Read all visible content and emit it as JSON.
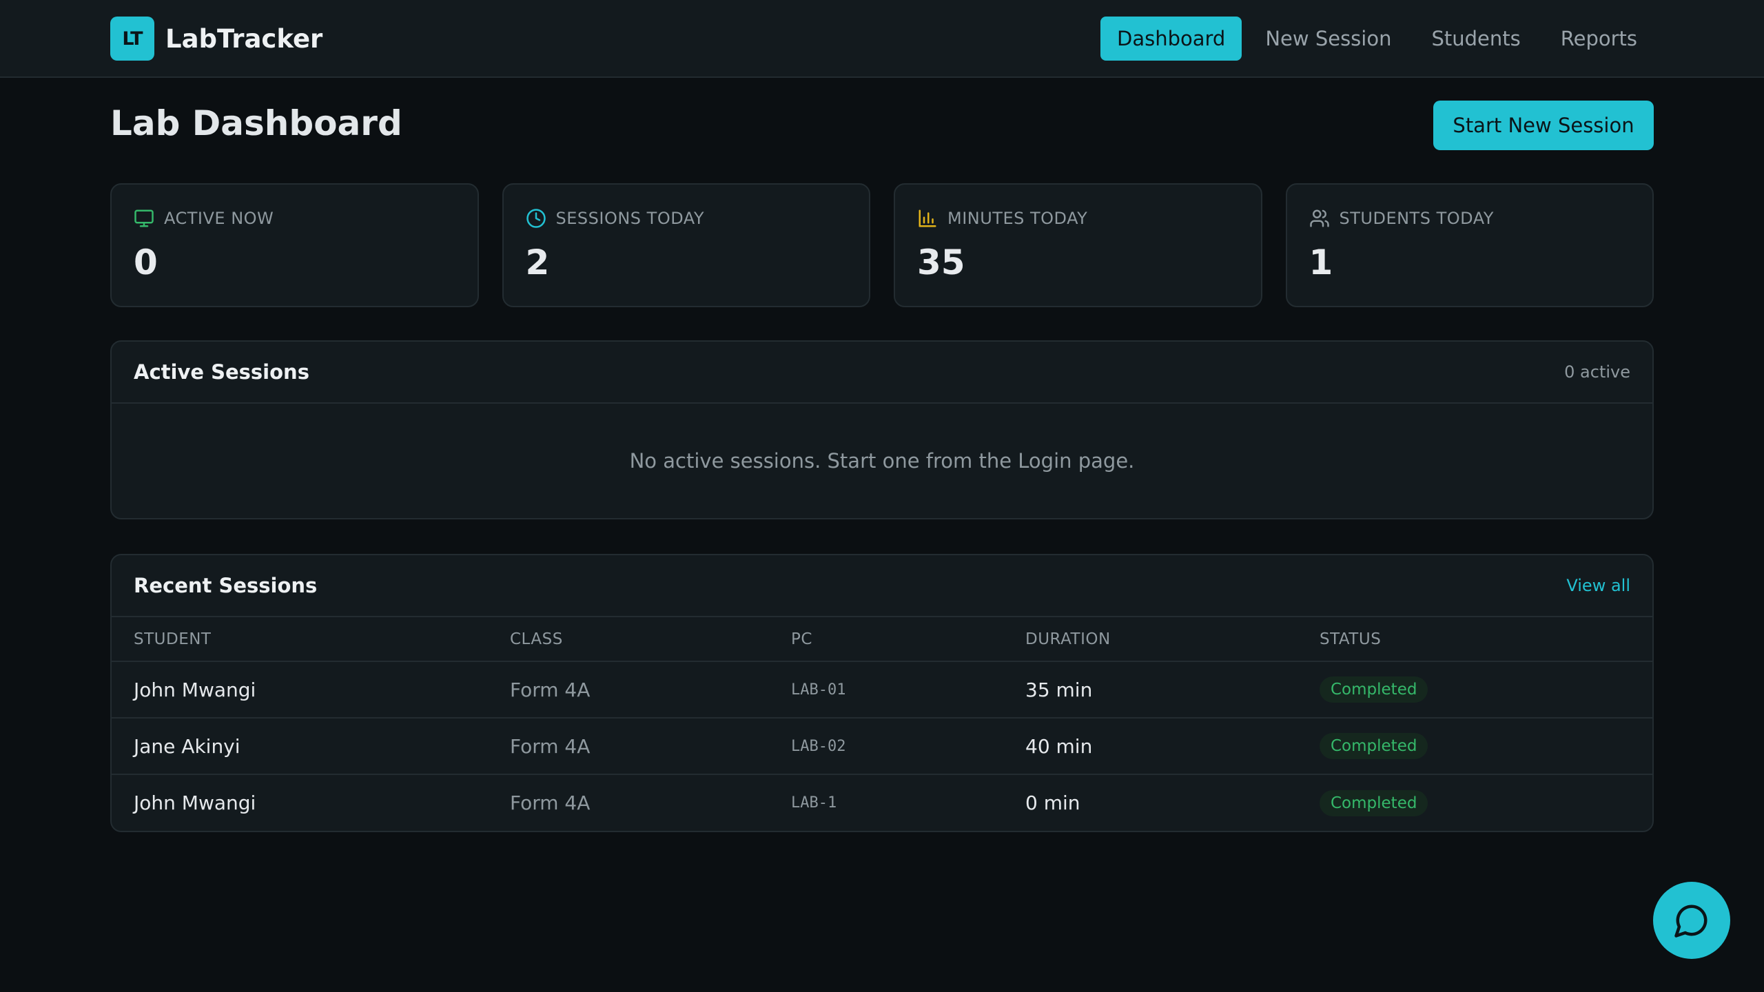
{
  "app": {
    "logo_text": "LT",
    "name": "LabTracker"
  },
  "nav": {
    "items": [
      {
        "label": "Dashboard",
        "active": true
      },
      {
        "label": "New Session",
        "active": false
      },
      {
        "label": "Students",
        "active": false
      },
      {
        "label": "Reports",
        "active": false
      }
    ]
  },
  "page": {
    "title": "Lab Dashboard",
    "primary_action": "Start New Session"
  },
  "stats": [
    {
      "icon": "monitor-icon",
      "label": "ACTIVE NOW",
      "value": "0",
      "icon_color": "#35b86a"
    },
    {
      "icon": "clock-icon",
      "label": "SESSIONS TODAY",
      "value": "2",
      "icon_color": "#22c1d2"
    },
    {
      "icon": "bar-chart-icon",
      "label": "MINUTES TODAY",
      "value": "35",
      "icon_color": "#e2b31a"
    },
    {
      "icon": "users-icon",
      "label": "STUDENTS TODAY",
      "value": "1",
      "icon_color": "#8f999f"
    }
  ],
  "active_sessions": {
    "title": "Active Sessions",
    "count_text": "0 active",
    "empty_message": "No active sessions. Start one from the Login page."
  },
  "recent_sessions": {
    "title": "Recent Sessions",
    "view_all": "View all",
    "columns": [
      "STUDENT",
      "CLASS",
      "PC",
      "DURATION",
      "STATUS"
    ],
    "rows": [
      {
        "student": "John Mwangi",
        "class": "Form 4A",
        "pc": "LAB-01",
        "duration": "35 min",
        "status": "Completed"
      },
      {
        "student": "Jane Akinyi",
        "class": "Form 4A",
        "pc": "LAB-02",
        "duration": "40 min",
        "status": "Completed"
      },
      {
        "student": "John Mwangi",
        "class": "Form 4A",
        "pc": "LAB-1",
        "duration": "0 min",
        "status": "Completed"
      }
    ]
  },
  "colors": {
    "accent": "#22c1d2",
    "background": "#0b0f12",
    "surface": "#131a1e",
    "success": "#35b86a"
  },
  "chat": {
    "icon": "chat-bubble-icon"
  }
}
